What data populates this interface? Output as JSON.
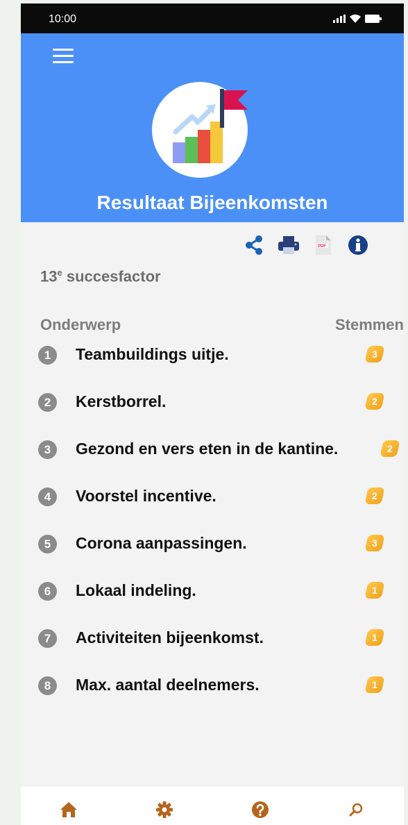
{
  "status": {
    "time": "10:00"
  },
  "header": {
    "title": "Resultaat Bijeenkomsten"
  },
  "section": {
    "prefix": "13",
    "sup": "e",
    "suffix": "succesfactor"
  },
  "columns": {
    "left": "Onderwerp",
    "right": "Stemmen"
  },
  "items": [
    {
      "num": "1",
      "label": "Teambuildings uitje.",
      "votes": "3"
    },
    {
      "num": "2",
      "label": "Kerstborrel.",
      "votes": "2"
    },
    {
      "num": "3",
      "label": "Gezond en vers eten in de kantine.",
      "votes": "2"
    },
    {
      "num": "4",
      "label": "Voorstel incentive.",
      "votes": "2"
    },
    {
      "num": "5",
      "label": "Corona aanpassingen.",
      "votes": "3"
    },
    {
      "num": "6",
      "label": "Lokaal indeling.",
      "votes": "1"
    },
    {
      "num": "7",
      "label": "Activiteiten bijeenkomst.",
      "votes": "1"
    },
    {
      "num": "8",
      "label": "Max. aantal deelnemers.",
      "votes": "1"
    }
  ],
  "icons": {
    "actions": [
      "share-icon",
      "print-icon",
      "pdf-icon",
      "info-icon"
    ],
    "nav": [
      "home-icon",
      "gear-icon",
      "help-icon",
      "search-icon"
    ]
  },
  "colors": {
    "header": "#4a90f7",
    "accent": "#1b63b5",
    "vote_badge": "#f0a21a",
    "nav_icon": "#b5651d"
  }
}
